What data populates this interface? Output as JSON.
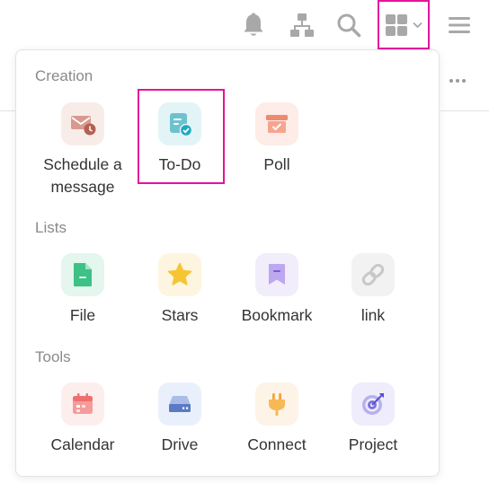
{
  "header": {
    "icons": [
      "bell-icon",
      "org-chart-icon",
      "search-icon",
      "apps-grid-icon",
      "chevron-down-icon",
      "hamburger-menu-icon"
    ]
  },
  "menu": {
    "sections": [
      {
        "title": "Creation",
        "items": [
          {
            "label": "Schedule a message",
            "icon": "schedule-message-icon",
            "bg": "#f8ece9"
          },
          {
            "label": "To-Do",
            "icon": "todo-icon",
            "bg": "#e3f4f7"
          },
          {
            "label": "Poll",
            "icon": "poll-icon",
            "bg": "#fdece7"
          }
        ]
      },
      {
        "title": "Lists",
        "items": [
          {
            "label": "File",
            "icon": "file-icon",
            "bg": "#e4f6ee"
          },
          {
            "label": "Stars",
            "icon": "star-icon",
            "bg": "#fdf5e0"
          },
          {
            "label": "Bookmark",
            "icon": "bookmark-icon",
            "bg": "#f1edfb"
          },
          {
            "label": "link",
            "icon": "link-icon",
            "bg": "#f2f2f2"
          }
        ]
      },
      {
        "title": "Tools",
        "items": [
          {
            "label": "Calendar",
            "icon": "calendar-icon",
            "bg": "#fdeeee"
          },
          {
            "label": "Drive",
            "icon": "drive-icon",
            "bg": "#eaf0fb"
          },
          {
            "label": "Connect",
            "icon": "connect-plug-icon",
            "bg": "#fdf3e6"
          },
          {
            "label": "Project",
            "icon": "project-target-icon",
            "bg": "#efedfb"
          }
        ]
      }
    ]
  },
  "colors": {
    "highlight": "#e5139d",
    "icon_gray": "#a8a8a8"
  }
}
